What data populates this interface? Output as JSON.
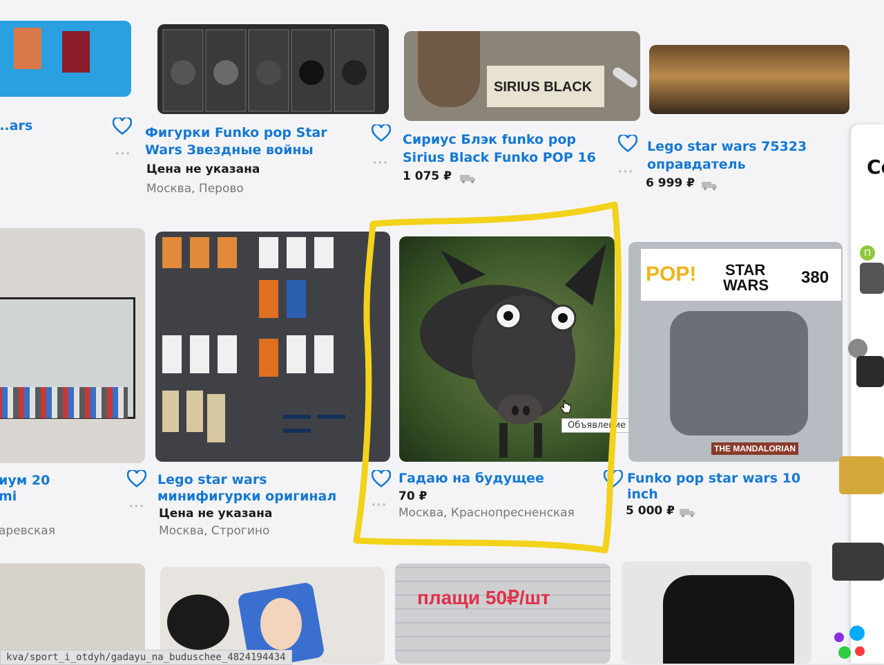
{
  "colors": {
    "link": "#1478d4",
    "marker": "#f2d21b",
    "background": "#f4f4f7"
  },
  "listings_row1": [
    {
      "title_line1": "...ars",
      "title_line2": ""
    },
    {
      "title_line1": "Фигурки Funko pop Star",
      "title_line2": "Wars Звездные войны",
      "price": "Цена не указана",
      "location": "Москва, Перово",
      "image_text": ""
    },
    {
      "title_line1": "Сириус Блэк funko pop",
      "title_line2": "Sirius Black Funko POP 16",
      "price": "1 075 ₽",
      "image_text": "SIRIUS BLACK"
    },
    {
      "title_line1": "Lego star wars 75323",
      "title_line2": "оправдатель",
      "price": "6 999 ₽"
    }
  ],
  "listings_row2": [
    {
      "title_line1": "иум 20",
      "title_line2": "mi",
      "location": "аревская"
    },
    {
      "title_line1": "Lego star wars",
      "title_line2": "минифигурки оригинал",
      "price": "Цена не указана",
      "location": "Москва, Строгино"
    },
    {
      "title_line1": "Гадаю на будущее",
      "price": "70 ₽",
      "location": "Москва, Краснопресненская"
    },
    {
      "title_line1": "Funko pop star wars 10",
      "title_line2": "inch",
      "price": "5 000 ₽",
      "image_pop": "POP!",
      "image_brand_1": "STAR",
      "image_brand_2": "WARS",
      "image_number": "380",
      "image_label": "THE MANDALORIAN"
    }
  ],
  "row3": {
    "banner_text": "плащи 50₽/шт"
  },
  "tooltip": "Объявление «Гадаю на будущее»",
  "status_url": "kva/sport_i_otdyh/gadayu_na_buduschee_4824194434",
  "side_panel": {
    "letter": "Се",
    "avatar_letter": "П"
  },
  "icons": {
    "favorite": "heart-icon",
    "more": "more-dots-icon",
    "delivery": "truck-icon",
    "cursor": "hand-cursor-icon"
  }
}
